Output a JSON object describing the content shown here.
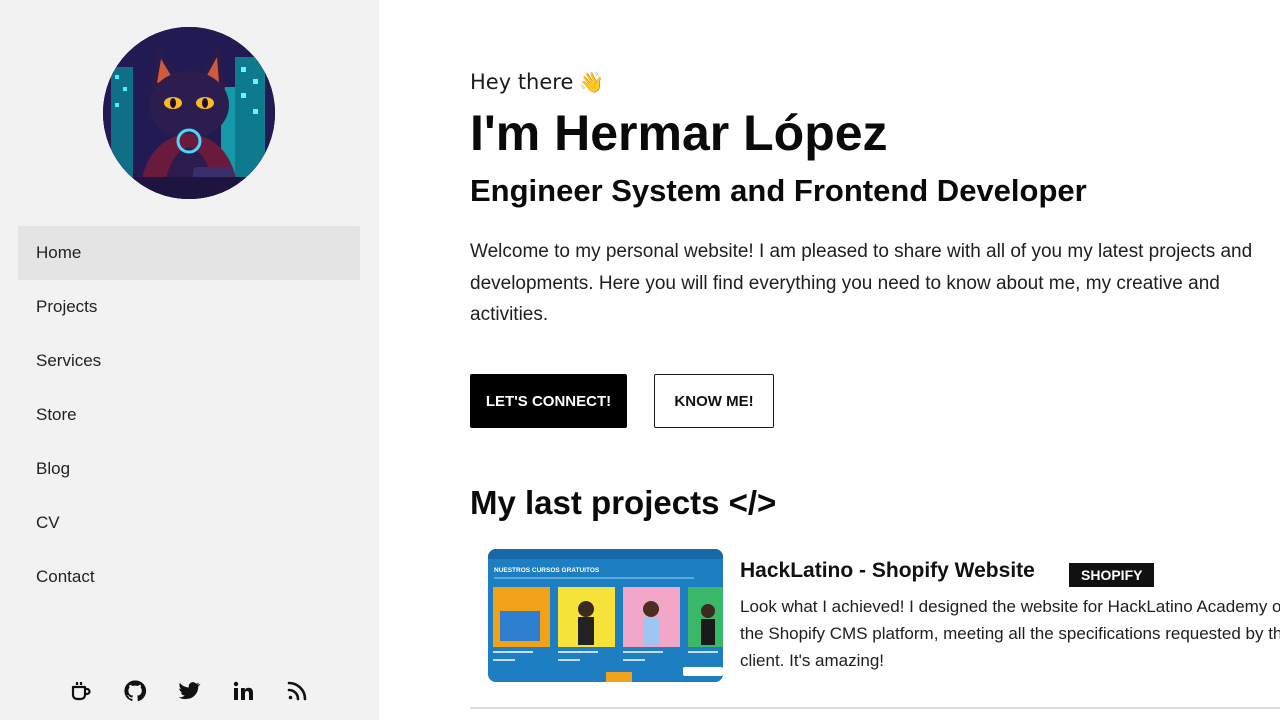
{
  "sidebar": {
    "avatar_alt": "",
    "items": [
      {
        "label": "Home",
        "active": true
      },
      {
        "label": "Projects",
        "active": false
      },
      {
        "label": "Services",
        "active": false
      },
      {
        "label": "Store",
        "active": false
      },
      {
        "label": "Blog",
        "active": false
      },
      {
        "label": "CV",
        "active": false
      },
      {
        "label": "Contact",
        "active": false
      }
    ],
    "socials": [
      "coffee-cup-icon",
      "github-icon",
      "twitter-icon",
      "linkedin-icon",
      "rss-icon"
    ]
  },
  "hero": {
    "greeting": "Hey there",
    "wave": "👋",
    "name": "I'm Hermar López",
    "role": "Engineer System and Frontend Developer",
    "intro": "Welcome to my personal website! I am pleased to share with all of you my latest projects and developments. Here you will find everything you need to know about me, my creative and activities.",
    "primary_button": "LET'S CONNECT!",
    "secondary_button": "KNOW ME!"
  },
  "projects": {
    "section_title": "My last projects </>",
    "items": [
      {
        "title": "HackLatino - Shopify Website",
        "badge": "SHOPIFY",
        "description": "Look what I achieved! I designed the website for HackLatino Academy on the Shopify CMS platform, meeting all the specifications requested by the client. It's amazing!",
        "thumbnail_heading": "NUESTROS CURSOS GRATUITOS"
      }
    ]
  },
  "colors": {
    "sidebar_bg": "#f2f2f2",
    "active_item_bg": "#e4e4e4",
    "primary_button_bg": "#000000",
    "thumbnail_bg": "#1d7fc2"
  }
}
